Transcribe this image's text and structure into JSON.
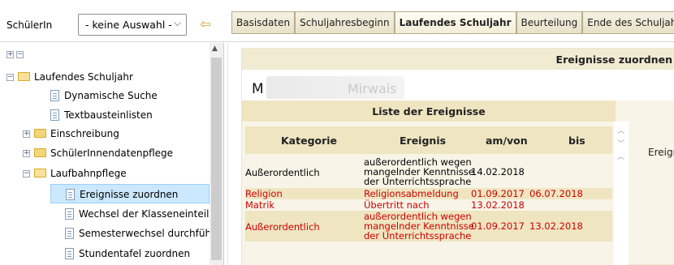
{
  "header": {
    "schueler_label": "SchülerIn",
    "select_value": "- keine Auswahl -",
    "tabs": [
      "Basisdaten",
      "Schuljahresbeginn",
      "Laufendes Schuljahr",
      "Beurteilung",
      "Ende des Schuljahres"
    ],
    "active_tab": "Laufendes Schuljahr"
  },
  "tree": {
    "root": "Laufendes Schuljahr",
    "items": [
      "Dynamische Suche",
      "Textbausteinlisten"
    ],
    "folders": [
      "Einschreibung",
      "SchülerInnendatenpflege",
      "Laufbahnpflege"
    ],
    "laufbahn_items": [
      "Ereignisse zuordnen",
      "Wechsel der Klasseneinteilung",
      "Semesterwechsel durchführe",
      "Stundentafel zuordnen"
    ],
    "selected": "Ereignisse zuordnen"
  },
  "main": {
    "panel_title": "Ereignisse zuordnen",
    "student_name_visible": "Mirwais",
    "student_initial": "M",
    "list_title": "Liste der Ereignisse",
    "columns": [
      "Kategorie",
      "Ereignis",
      "am/von",
      "bis"
    ],
    "rows": [
      {
        "kategorie": "Außerordentlich",
        "ereignis": [
          "außerordentlich wegen",
          "mangelnder Kenntnisse",
          "der Unterrichtssprache"
        ],
        "am_von": "14.02.2018",
        "bis": "",
        "highlight": false,
        "color": "black"
      },
      {
        "kategorie": "Religion",
        "ereignis": [
          "Religionsabmeldung"
        ],
        "am_von": "01.09.2017",
        "bis": "06.07.2018",
        "highlight": true,
        "color": "red"
      },
      {
        "kategorie": "Matrik",
        "ereignis": [
          "Übertritt nach"
        ],
        "am_von": "13.02.2018",
        "bis": "",
        "highlight": false,
        "color": "red"
      },
      {
        "kategorie": "Außerordentlich",
        "ereignis": [
          "außerordentlich wegen",
          "mangelnder Kenntnisse",
          "der Unterrichtssprache"
        ],
        "am_von": "01.09.2017",
        "bis": "13.02.2018",
        "highlight": true,
        "color": "red"
      }
    ],
    "right_label": "Ereign"
  },
  "colors": {
    "accent_bg": "#efe5c1",
    "panel_bg": "#f8f5e8",
    "red_text": "#cc0000",
    "selection": "#cce8ff"
  }
}
